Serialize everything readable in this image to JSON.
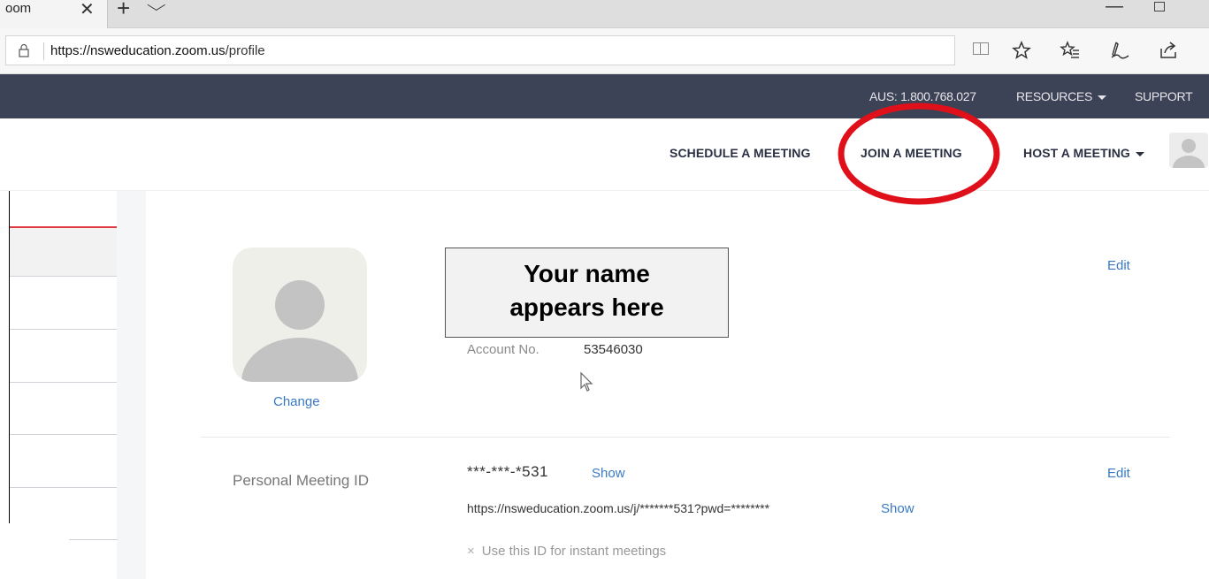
{
  "browser": {
    "tab_title": "oom",
    "tab_close": "✕",
    "new_tab": "+",
    "tab_list": "⌵",
    "win_min": "—",
    "url_domain": "https://nsweducation.zoom.us",
    "url_path": "/profile"
  },
  "topnav": {
    "phone": "AUS: 1.800.768.027",
    "resources": "RESOURCES",
    "support": "SUPPORT"
  },
  "secnav": {
    "schedule": "SCHEDULE A MEETING",
    "join": "JOIN A MEETING",
    "host": "HOST A MEETING"
  },
  "profile": {
    "change": "Change",
    "callout_line1": "Your name",
    "callout_line2": "appears here",
    "account_label": "Account No.",
    "account_value": "53546030",
    "edit": "Edit"
  },
  "meeting": {
    "label": "Personal Meeting ID",
    "id_value": "***-***-*531",
    "show": "Show",
    "edit": "Edit",
    "url": "https://nsweducation.zoom.us/j/*******531?pwd=********",
    "url_show": "Show",
    "instant": "Use this ID for instant meetings",
    "instant_icon": "×"
  },
  "colors": {
    "nav_dark": "#3d4356",
    "link_blue": "#3979c4",
    "annotation_red": "#e0101a",
    "active_red": "#e0383f"
  }
}
